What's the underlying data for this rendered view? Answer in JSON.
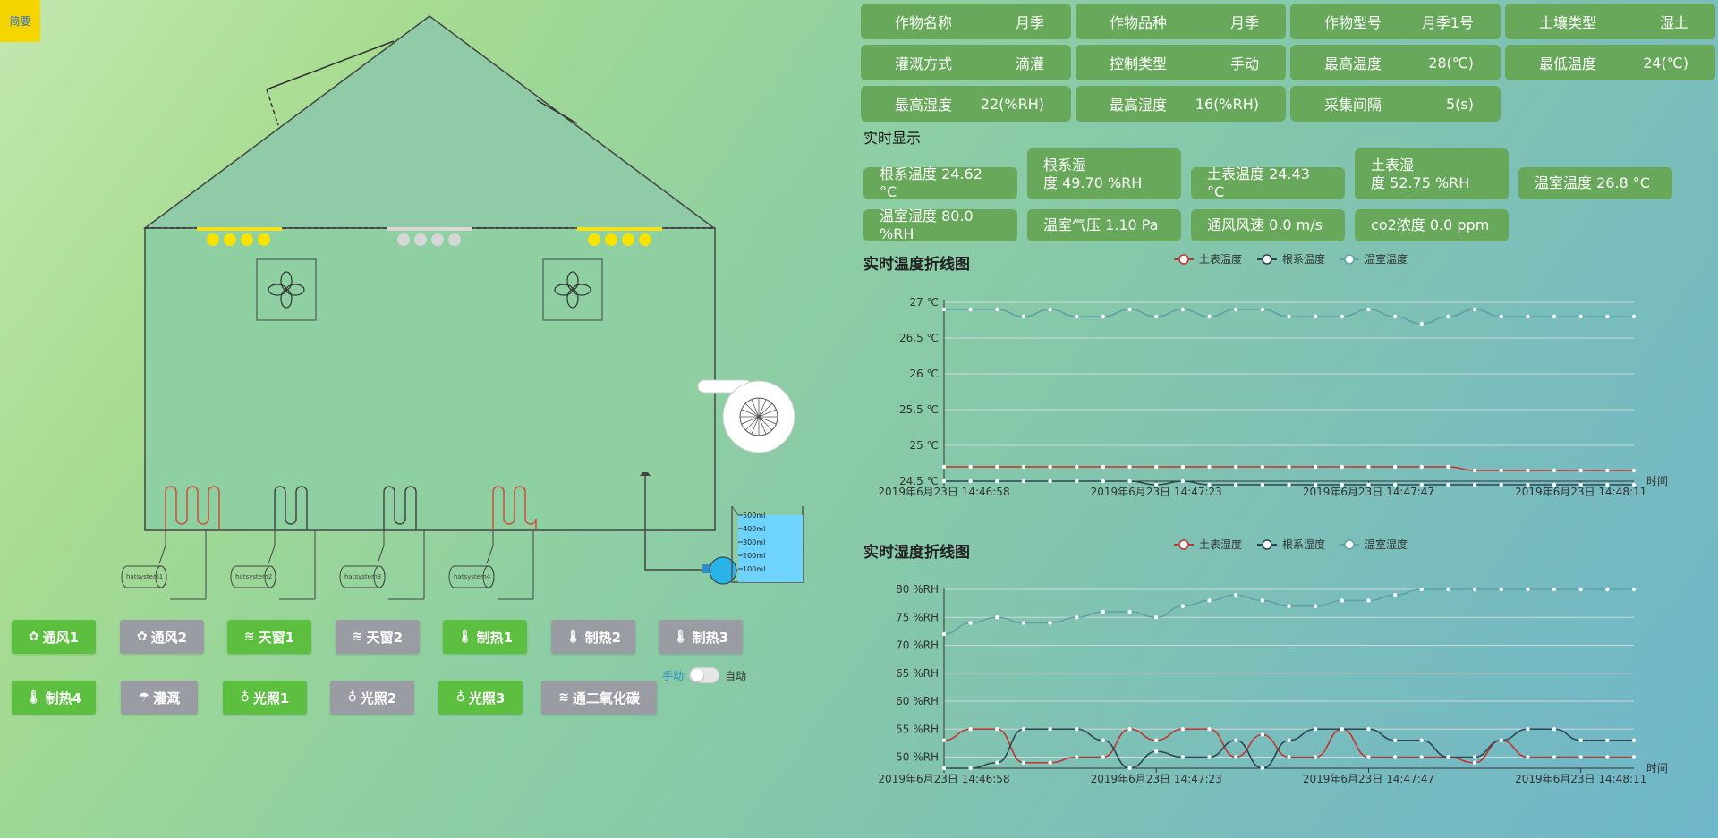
{
  "corner_button": "简要",
  "devices": {
    "heaters": [
      "hatsystem1",
      "hatsystem2",
      "hatsystem3",
      "hatsystem4"
    ],
    "beaker_marks": [
      "500ml",
      "400ml",
      "300ml",
      "200ml",
      "100ml"
    ]
  },
  "controls": [
    {
      "label": "通风1",
      "icon": "fan-icon",
      "glyph": "✿",
      "state": "on"
    },
    {
      "label": "通风2",
      "icon": "fan-icon",
      "glyph": "✿",
      "state": "off"
    },
    {
      "label": "天窗1",
      "icon": "window-icon",
      "glyph": "≋",
      "state": "on"
    },
    {
      "label": "天窗2",
      "icon": "window-icon",
      "glyph": "≋",
      "state": "off"
    },
    {
      "label": "制热1",
      "icon": "thermometer-icon",
      "glyph": "🌡",
      "state": "on"
    },
    {
      "label": "制热2",
      "icon": "thermometer-icon",
      "glyph": "🌡",
      "state": "off"
    },
    {
      "label": "制热3",
      "icon": "thermometer-icon",
      "glyph": "🌡",
      "state": "off"
    },
    {
      "label": "制热4",
      "icon": "thermometer-icon",
      "glyph": "🌡",
      "state": "on"
    },
    {
      "label": "灌溉",
      "icon": "irrigation-icon",
      "glyph": "☂",
      "state": "off"
    },
    {
      "label": "光照1",
      "icon": "bulb-icon",
      "glyph": "♁",
      "state": "on"
    },
    {
      "label": "光照2",
      "icon": "bulb-icon",
      "glyph": "♁",
      "state": "off"
    },
    {
      "label": "光照3",
      "icon": "bulb-icon",
      "glyph": "♁",
      "state": "on"
    },
    {
      "label": "通二氧化碳",
      "icon": "co2-icon",
      "glyph": "≋",
      "state": "off"
    }
  ],
  "mode": {
    "manual": "手动",
    "auto": "自动"
  },
  "crop_info": [
    {
      "key": "作物名称",
      "value": "月季"
    },
    {
      "key": "作物品种",
      "value": "月季"
    },
    {
      "key": "作物型号",
      "value": "月季1号"
    },
    {
      "key": "土壤类型",
      "value": "湿土"
    },
    {
      "key": "灌溉方式",
      "value": "滴灌"
    },
    {
      "key": "控制类型",
      "value": "手动"
    },
    {
      "key": "最高温度",
      "value": "28(℃)"
    },
    {
      "key": "最低温度",
      "value": "24(℃)"
    },
    {
      "key": "最高湿度",
      "value": "22(%RH)"
    },
    {
      "key": "最高湿度",
      "value": "16(%RH)"
    },
    {
      "key": "采集间隔",
      "value": "5(s)"
    }
  ],
  "realtime_title": "实时显示",
  "realtime": [
    {
      "line1": "根系温度 24.62 °C",
      "line2": ""
    },
    {
      "line1": "根系湿",
      "line2": "度 49.70 %RH"
    },
    {
      "line1": "土表温度 24.43 °C",
      "line2": ""
    },
    {
      "line1": "土表湿",
      "line2": "度 52.75 %RH"
    },
    {
      "line1": "温室温度 26.8 °C",
      "line2": ""
    },
    {
      "line1": "温室湿度 80.0 %RH",
      "line2": ""
    },
    {
      "line1": "温室气压 1.10 Pa",
      "line2": ""
    },
    {
      "line1": "通风风速 0.0 m/s",
      "line2": ""
    },
    {
      "line1": "co2浓度 0.0 ppm",
      "line2": ""
    }
  ],
  "chart_data": [
    {
      "type": "line",
      "title": "实时温度折线图",
      "xlabel": "时间",
      "ylabel": "",
      "unit": "℃",
      "ylim": [
        24.5,
        27
      ],
      "yticks": [
        "24.5 ℃",
        "25 ℃",
        "25.5 ℃",
        "26 ℃",
        "26.5 ℃",
        "27 ℃"
      ],
      "xticks": [
        "2019年6月23日 14:46:58",
        "2019年6月23日 14:47:23",
        "2019年6月23日 14:47:47",
        "2019年6月23日 14:48:11"
      ],
      "colors": [
        "#c23531",
        "#2f4554",
        "#61a0a8"
      ],
      "series": [
        {
          "name": "土表温度",
          "values": [
            24.7,
            24.7,
            24.7,
            24.7,
            24.7,
            24.7,
            24.7,
            24.7,
            24.7,
            24.7,
            24.7,
            24.7,
            24.7,
            24.7,
            24.7,
            24.7,
            24.7,
            24.7,
            24.7,
            24.7,
            24.65,
            24.65,
            24.65,
            24.65,
            24.65,
            24.65,
            24.65
          ]
        },
        {
          "name": "根系温度",
          "values": [
            24.5,
            24.5,
            24.5,
            24.5,
            24.5,
            24.5,
            24.5,
            24.5,
            24.45,
            24.5,
            24.45,
            24.45,
            24.45,
            24.45,
            24.45,
            24.45,
            24.45,
            24.45,
            24.45,
            24.45,
            24.45,
            24.45,
            24.45,
            24.45,
            24.45,
            24.45,
            24.45
          ]
        },
        {
          "name": "温室温度",
          "values": [
            26.9,
            26.9,
            26.9,
            26.8,
            26.9,
            26.8,
            26.8,
            26.9,
            26.8,
            26.9,
            26.8,
            26.9,
            26.9,
            26.8,
            26.8,
            26.8,
            26.9,
            26.8,
            26.7,
            26.8,
            26.9,
            26.8,
            26.8,
            26.8,
            26.8,
            26.8,
            26.8
          ]
        }
      ]
    },
    {
      "type": "line",
      "title": "实时湿度折线图",
      "xlabel": "时间",
      "ylabel": "",
      "unit": "%RH",
      "ylim": [
        48,
        80
      ],
      "yticks": [
        "50 %RH",
        "55 %RH",
        "60 %RH",
        "65 %RH",
        "70 %RH",
        "75 %RH",
        "80 %RH"
      ],
      "xticks": [
        "2019年6月23日 14:46:58",
        "2019年6月23日 14:47:23",
        "2019年6月23日 14:47:47",
        "2019年6月23日 14:48:11"
      ],
      "colors": [
        "#c23531",
        "#2f4554",
        "#61a0a8"
      ],
      "series": [
        {
          "name": "土表湿度",
          "values": [
            53,
            55,
            55,
            49,
            49,
            50,
            50,
            55,
            53,
            55,
            55,
            50,
            54,
            50,
            50,
            55,
            50,
            50,
            50,
            50,
            49,
            53,
            50,
            50,
            50,
            50,
            50
          ]
        },
        {
          "name": "根系湿度",
          "values": [
            48,
            48,
            49,
            55,
            55,
            55,
            53,
            48,
            51,
            50,
            50,
            53,
            48,
            53,
            55,
            55,
            55,
            53,
            53,
            50,
            50,
            53,
            55,
            55,
            53,
            53,
            53
          ]
        },
        {
          "name": "温室湿度",
          "values": [
            72,
            74,
            75,
            74,
            74,
            75,
            76,
            76,
            75,
            77,
            78,
            79,
            78,
            77,
            77,
            78,
            78,
            79,
            80,
            80,
            80,
            80,
            80,
            80,
            80,
            80,
            80
          ]
        }
      ]
    }
  ]
}
